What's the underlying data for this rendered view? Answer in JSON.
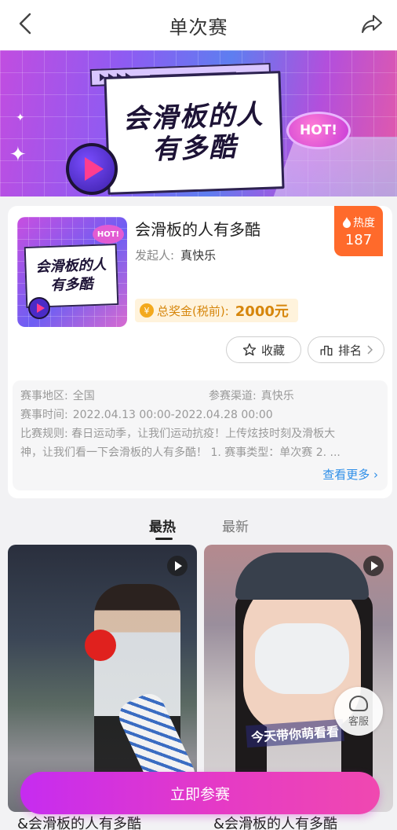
{
  "header": {
    "title": "单次赛"
  },
  "banner": {
    "line1": "会滑板的人",
    "line2": "有多酷",
    "hot": "HOT!"
  },
  "event": {
    "title": "会滑板的人有多酷",
    "organizer_label": "发起人:",
    "organizer": "真快乐",
    "heat_label": "热度",
    "heat_value": "187",
    "prize_label": "总奖金(税前):",
    "prize_amount": "2000元",
    "favorite_label": "收藏",
    "ranking_label": "排名",
    "thumb_line1": "会滑板的人",
    "thumb_line2": "有多酷",
    "thumb_hot": "HOT!"
  },
  "details": {
    "region_label": "赛事地区:",
    "region": "全国",
    "channel_label": "参赛渠道:",
    "channel": "真快乐",
    "time_label": "赛事时间:",
    "time": "2022.04.13 00:00-2022.04.28 00:00",
    "rules_line1": "比赛规则: 春日运动季，让我们运动抗疫！上传炫技时刻及滑板大",
    "rules_line2": "神，让我们看一下会滑板的人有多酷！ 1. 赛事类型：单次赛 2. ...",
    "more": "查看更多"
  },
  "tabs": [
    {
      "label": "最热"
    },
    {
      "label": "最新"
    }
  ],
  "videos": [
    {
      "title": "&会滑板的人有多酷"
    },
    {
      "title": "&会滑板的人有多酷",
      "caption": "今天带你萌看看"
    }
  ],
  "service_label": "客服",
  "join_label": "立即参赛",
  "colors": {
    "accent_orange": "#ff6a2b",
    "link_blue": "#2d8ee8",
    "join_gradient_start": "#c62cf0",
    "join_gradient_end": "#f048b0"
  }
}
